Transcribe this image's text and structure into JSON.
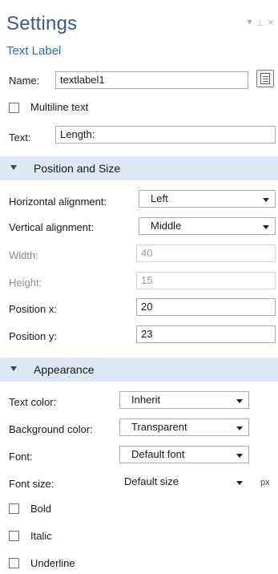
{
  "header": {
    "title": "Settings",
    "subtitle": "Text Label"
  },
  "general": {
    "name_label": "Name:",
    "name_value": "textlabel1",
    "multiline_label": "Multiline text",
    "text_label": "Text:",
    "text_value": "Length:"
  },
  "position_section": {
    "title": "Position and Size",
    "horizontal_label": "Horizontal alignment:",
    "horizontal_value": "Left",
    "vertical_label": "Vertical alignment:",
    "vertical_value": "Middle",
    "width_label": "Width:",
    "width_value": "40",
    "height_label": "Height:",
    "height_value": "15",
    "posx_label": "Position x:",
    "posx_value": "20",
    "posy_label": "Position y:",
    "posy_value": "23"
  },
  "appearance_section": {
    "title": "Appearance",
    "text_color_label": "Text color:",
    "text_color_value": "Inherit",
    "bg_color_label": "Background color:",
    "bg_color_value": "Transparent",
    "font_label": "Font:",
    "font_value": "Default font",
    "font_size_label": "Font size:",
    "font_size_value": "Default size",
    "font_size_unit": "px",
    "bold_label": "Bold",
    "italic_label": "Italic",
    "underline_label": "Underline"
  },
  "icons": {
    "edit": "edit-text-icon",
    "dropdown": "chevron-down-icon",
    "collapse": "collapse-triangle-icon",
    "window_menu": "window-menu-icon",
    "pin": "pin-icon",
    "close": "close-icon"
  },
  "colors": {
    "title": "#3a5a86",
    "subtitle": "#2f6fb6",
    "section_bg": "#dde8f4"
  }
}
